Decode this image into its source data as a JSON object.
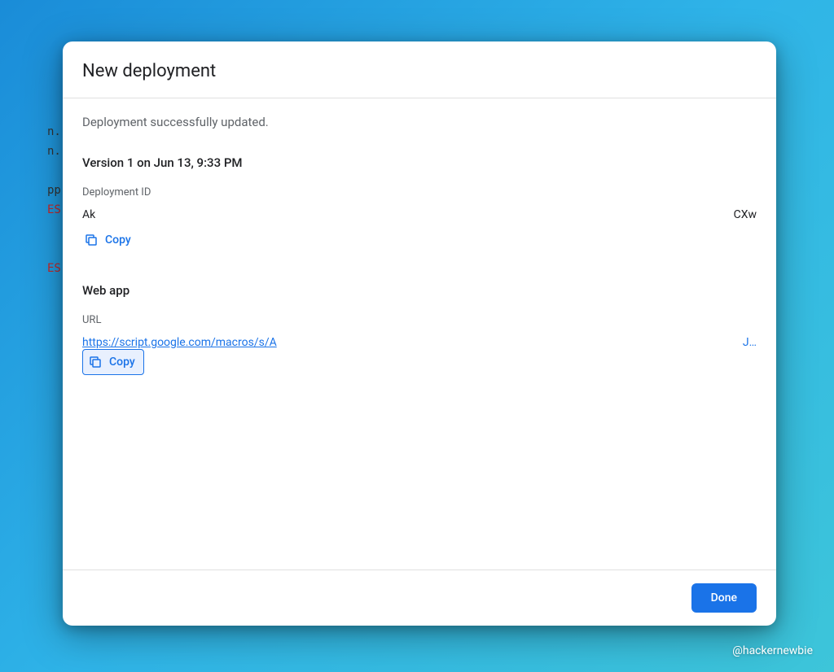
{
  "background": {
    "lines": [
      "n.",
      "n.",
      "",
      "pp",
      "ES",
      "",
      "",
      "ES"
    ]
  },
  "modal": {
    "title": "New deployment",
    "status_message": "Deployment successfully updated.",
    "version_heading": "Version 1 on Jun 13, 9:33 PM",
    "deployment_id": {
      "label": "Deployment ID",
      "prefix": "Ak",
      "suffix": "CXw",
      "copy_label": "Copy"
    },
    "webapp": {
      "heading": "Web app",
      "url_label": "URL",
      "url_prefix": "https://script.google.com/macros/s/A",
      "url_suffix": "J…",
      "copy_label": "Copy"
    },
    "done_label": "Done"
  },
  "watermark": "@hackernewbie"
}
